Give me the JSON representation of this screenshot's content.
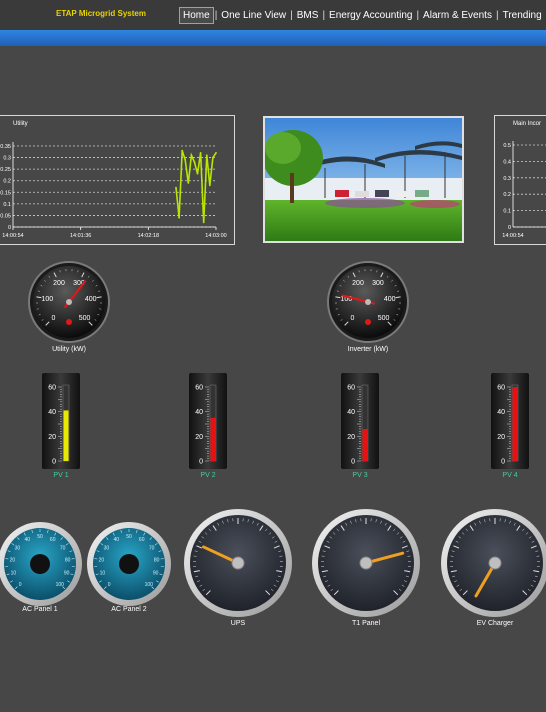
{
  "header": {
    "brand": "ETAP Microgrid System",
    "nav": [
      "Home",
      "One Line View",
      "BMS",
      "Energy Accounting",
      "Alarm & Events",
      "Trending"
    ],
    "active": "Home"
  },
  "utility_chart": {
    "title": "Utility",
    "y_ticks": [
      "0.35",
      "0.3",
      "0.25",
      "0.2",
      "0.15",
      "0.1",
      "0.05",
      "0"
    ],
    "x_ticks": [
      "14:00:54",
      "14:01:36",
      "14:02:18",
      "14:03:00"
    ]
  },
  "main_chart": {
    "title": "Main Incor",
    "y_ticks": [
      "0.5",
      "0.4",
      "0.3",
      "0.2",
      "0.1",
      "0"
    ],
    "x_ticks": [
      "14:00:54"
    ]
  },
  "chart_data": [
    {
      "type": "line",
      "title": "Utility",
      "ylim": [
        0,
        0.35
      ],
      "x_ticks": [
        "14:00:54",
        "14:01:36",
        "14:02:18",
        "14:03:00"
      ],
      "series": [
        {
          "values": [
            0.17,
            0.04,
            0.33,
            0.29,
            0.19,
            0.31,
            0.28,
            0.23,
            0.32,
            0.02,
            0.31,
            0.18,
            0.3,
            0.32
          ]
        }
      ]
    },
    {
      "type": "line",
      "title": "Main Incor",
      "ylim": [
        0,
        0.5
      ],
      "x_ticks": [
        "14:00:54"
      ],
      "series": []
    }
  ],
  "dial_gauges": [
    {
      "label": "Utility (kW)",
      "ticks": [
        "0",
        "100",
        "200",
        "300",
        "400",
        "500"
      ],
      "value": 320
    },
    {
      "label": "Inverter (kW)",
      "ticks": [
        "0",
        "100",
        "200",
        "300",
        "400",
        "500"
      ],
      "value": 110
    }
  ],
  "thermometers": [
    {
      "label": "PV 1",
      "ticks": [
        "60",
        "40",
        "20",
        "0"
      ],
      "value": 41,
      "color": "#e8e800"
    },
    {
      "label": "PV 2",
      "ticks": [
        "60",
        "40",
        "20",
        "0"
      ],
      "value": 35,
      "color": "#e81010"
    },
    {
      "label": "PV 3",
      "ticks": [
        "60",
        "40",
        "20",
        "0"
      ],
      "value": 26,
      "color": "#e81010"
    },
    {
      "label": "PV 4",
      "ticks": [
        "60",
        "40",
        "20",
        "0"
      ],
      "value": 60,
      "color": "#e81010"
    }
  ],
  "bottom_gauges": [
    {
      "label": "AC Panel 1",
      "style": "teal"
    },
    {
      "label": "AC Panel 2",
      "style": "teal"
    },
    {
      "label": "UPS",
      "style": "dark"
    },
    {
      "label": "T1 Panel",
      "style": "dark"
    },
    {
      "label": "EV Charger",
      "style": "dark"
    }
  ]
}
